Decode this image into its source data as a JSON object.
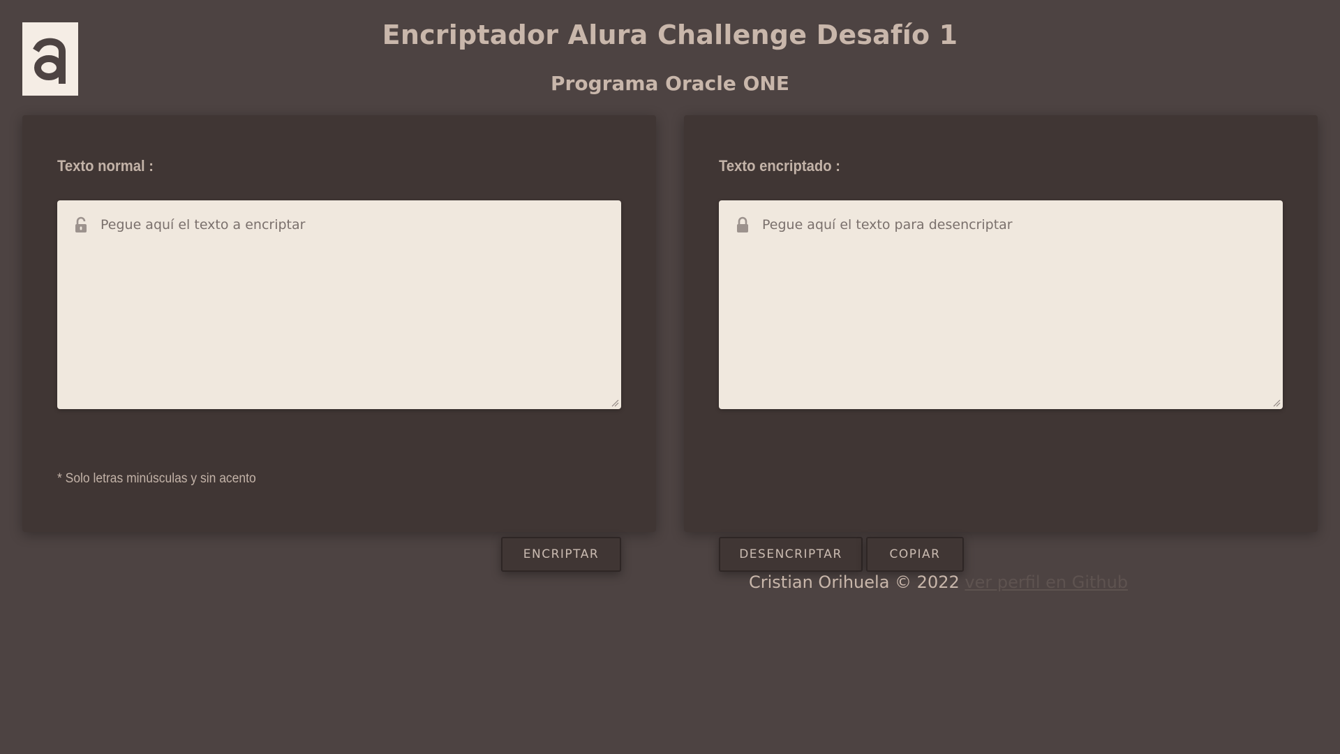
{
  "header": {
    "logo_letter": "a",
    "title": "Encriptador Alura Challenge Desafío 1",
    "subtitle": "Programa Oracle ONE"
  },
  "left_panel": {
    "label": "Texto normal :",
    "input_placeholder": "Pegue aquí el texto a encriptar",
    "input_value": "",
    "lock_icon": "unlocked-lock-icon",
    "encrypt_button": "ENCRIPTAR",
    "note": "* Solo letras minúsculas y sin acento"
  },
  "right_panel": {
    "label": "Texto encriptado :",
    "input_placeholder": "Pegue aquí el texto para desencriptar",
    "input_value": "",
    "lock_icon": "locked-lock-icon",
    "decrypt_button": "DESENCRIPTAR",
    "copy_button": "COPIAR"
  },
  "footer": {
    "author": "Cristian Orihuela © 2022",
    "link_text": "ver perfil en Github"
  },
  "colors": {
    "background": "#4d4342",
    "panel": "#403634",
    "textbox": "#f0e8de",
    "heading_text": "#c9b7ab"
  }
}
